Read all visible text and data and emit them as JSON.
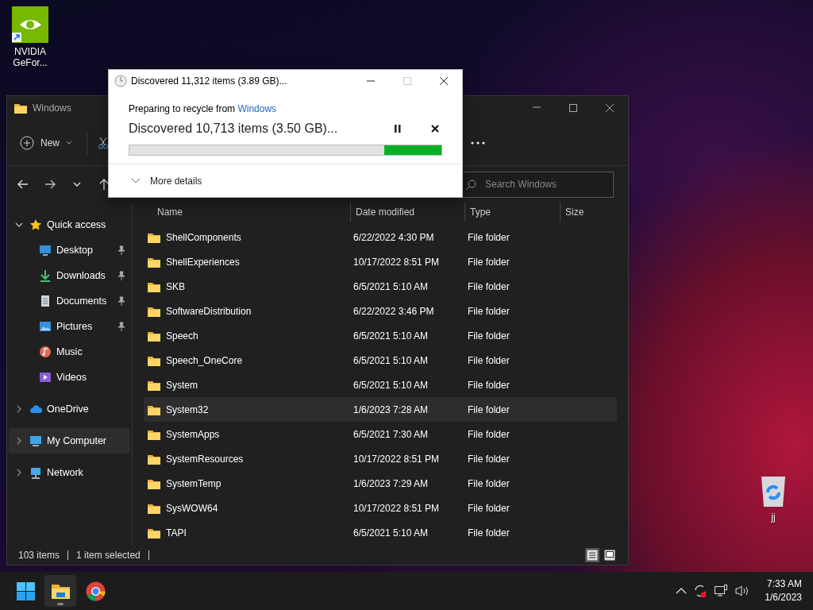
{
  "desktop_icons": [
    {
      "kind": "nvidia",
      "label": "NVIDIA GeFor..."
    },
    {
      "kind": "recycle",
      "label": "jj"
    }
  ],
  "explorer": {
    "title": "Windows",
    "new_label": "New",
    "search": {
      "placeholder": "Search Windows"
    },
    "sidebar": [
      {
        "kind": "star",
        "label": "Quick access",
        "expanded": true,
        "selected": false,
        "children": [
          {
            "kind": "desktop",
            "label": "Desktop",
            "pinned": true,
            "selected": false
          },
          {
            "kind": "download",
            "label": "Downloads",
            "pinned": true,
            "selected": false
          },
          {
            "kind": "document",
            "label": "Documents",
            "pinned": true,
            "selected": false
          },
          {
            "kind": "picture",
            "label": "Pictures",
            "pinned": true,
            "selected": false
          },
          {
            "kind": "music",
            "label": "Music",
            "pinned": false,
            "selected": false
          },
          {
            "kind": "video",
            "label": "Videos",
            "pinned": false,
            "selected": false
          }
        ]
      },
      {
        "kind": "cloud",
        "label": "OneDrive",
        "expanded": false,
        "selected": false
      },
      {
        "kind": "computer",
        "label": "My Computer",
        "expanded": false,
        "selected": true
      },
      {
        "kind": "network",
        "label": "Network",
        "expanded": false,
        "selected": false
      }
    ],
    "columns": [
      "Name",
      "Date modified",
      "Type",
      "Size"
    ],
    "rows": [
      {
        "name": "ShellComponents",
        "date": "6/22/2022 4:30 PM",
        "type": "File folder",
        "selected": false
      },
      {
        "name": "ShellExperiences",
        "date": "10/17/2022 8:51 PM",
        "type": "File folder",
        "selected": false
      },
      {
        "name": "SKB",
        "date": "6/5/2021 5:10 AM",
        "type": "File folder",
        "selected": false
      },
      {
        "name": "SoftwareDistribution",
        "date": "6/22/2022 3:46 PM",
        "type": "File folder",
        "selected": false
      },
      {
        "name": "Speech",
        "date": "6/5/2021 5:10 AM",
        "type": "File folder",
        "selected": false
      },
      {
        "name": "Speech_OneCore",
        "date": "6/5/2021 5:10 AM",
        "type": "File folder",
        "selected": false
      },
      {
        "name": "System",
        "date": "6/5/2021 5:10 AM",
        "type": "File folder",
        "selected": false
      },
      {
        "name": "System32",
        "date": "1/6/2023 7:28 AM",
        "type": "File folder",
        "selected": true
      },
      {
        "name": "SystemApps",
        "date": "6/5/2021 7:30 AM",
        "type": "File folder",
        "selected": false
      },
      {
        "name": "SystemResources",
        "date": "10/17/2022 8:51 PM",
        "type": "File folder",
        "selected": false
      },
      {
        "name": "SystemTemp",
        "date": "1/6/2023 7:29 AM",
        "type": "File folder",
        "selected": false
      },
      {
        "name": "SysWOW64",
        "date": "10/17/2022 8:51 PM",
        "type": "File folder",
        "selected": false
      },
      {
        "name": "TAPI",
        "date": "6/5/2021 5:10 AM",
        "type": "File folder",
        "selected": false
      }
    ],
    "status": [
      "103 items",
      "1 item selected"
    ],
    "views": [
      {
        "kind": "details",
        "selected": true
      },
      {
        "kind": "tiles",
        "selected": false
      }
    ]
  },
  "dialog": {
    "title": "Discovered 11,312 items (3.89 GB)...",
    "source_prefix": "Preparing to recycle from",
    "source_link": "Windows",
    "status": "Discovered 10,713 items (3.50 GB)...",
    "indeterminate": true,
    "details_label": "More details"
  },
  "taskbar": {
    "apps": [
      {
        "kind": "start",
        "active": false
      },
      {
        "kind": "explorer",
        "active": true
      },
      {
        "kind": "chrome",
        "active": false
      }
    ],
    "clock": {
      "time": "7:33 AM",
      "date": "1/6/2023"
    }
  }
}
